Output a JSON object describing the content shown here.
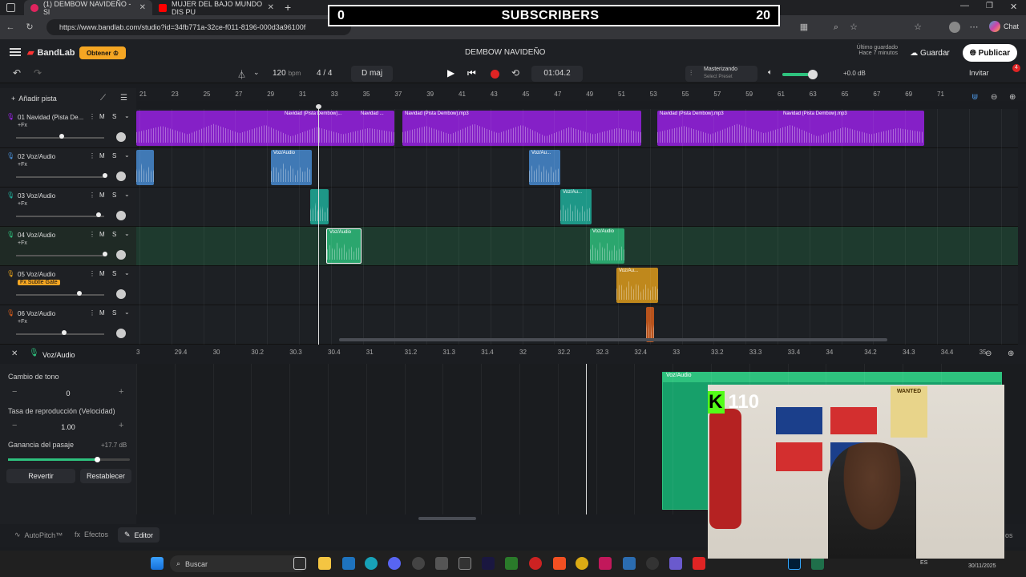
{
  "browser": {
    "tabs": [
      {
        "label": "(1) DEMBOW NAVIDEÑO - Sl"
      },
      {
        "label": "MUJER DEL BAJO MUNDO DIS PU"
      }
    ],
    "new_tab": "+",
    "url": "https://www.bandlab.com/studio?id=34fb771a-32ce-f011-8196-000d3a96100f",
    "chat_label": "Chat"
  },
  "overlay": {
    "left": "0",
    "label": "SUBSCRIBERS",
    "right": "20"
  },
  "app": {
    "brand": "BandLab",
    "get_button": "Obtener",
    "project_title": "DEMBOW NAVIDEÑO",
    "saved_line1": "Último guardado",
    "saved_line2": "Hace 7 minutos",
    "save_button": "Guardar",
    "publish_button": "Publicar",
    "invite_button": "Invitar",
    "invite_badge": "4"
  },
  "transport": {
    "bpm": "120",
    "bpm_unit": "bpm",
    "signature": "4 / 4",
    "key": "D maj",
    "time": "01:04.2",
    "mastering_title": "Masterizando",
    "mastering_sub": "Select Preset",
    "db": "+0.0 dB"
  },
  "tracks_header": {
    "add_track": "Añadir pista"
  },
  "ruler": [
    "21",
    "23",
    "25",
    "27",
    "29",
    "31",
    "33",
    "35",
    "37",
    "39",
    "41",
    "43",
    "45",
    "47",
    "49",
    "51",
    "53",
    "55",
    "57",
    "59",
    "61",
    "63",
    "65",
    "67",
    "69",
    "71"
  ],
  "tracks": [
    {
      "num": "01",
      "name": "Navidad (Pista De...",
      "fx": "+Fx",
      "color": "#a020f0",
      "vol": 0.5
    },
    {
      "num": "02",
      "name": "Voz/Audio",
      "fx": "+Fx",
      "color": "#4a90d9",
      "vol": 1.0
    },
    {
      "num": "03",
      "name": "Voz/Audio",
      "fx": "+Fx",
      "color": "#1fb5a0",
      "vol": 0.93
    },
    {
      "num": "04",
      "name": "Voz/Audio",
      "fx": "+Fx",
      "color": "#2ec27e",
      "vol": 1.0
    },
    {
      "num": "05",
      "name": "Voz/Audio",
      "fx": "Fx Subtle Gate",
      "color": "#e8a21a",
      "vol": 0.7
    },
    {
      "num": "06",
      "name": "Voz/Audio",
      "fx": "+Fx",
      "color": "#e0601a",
      "vol": 0.53
    }
  ],
  "track_buttons": {
    "m": "M",
    "s": "S"
  },
  "clips": {
    "t1": [
      "Navidad (Pista Dembow)...",
      "Navidad ...",
      "Navidad (Pista Dembow).mp3",
      "Navidad (Pista Dembow).mp3",
      "Navidad (Pista Dembow).mp3"
    ],
    "t2": [
      "Voz/Audio",
      "Voz/Au..."
    ],
    "t3": [
      "Voz/Au..."
    ],
    "t4": [
      "Voz/Audio",
      "Voz/Audio"
    ],
    "t5": [
      "Voz/Au..."
    ]
  },
  "editor": {
    "track_label": "Voz/Audio",
    "ruler": [
      "3",
      "29.4",
      "30",
      "30.2",
      "30.3",
      "30.4",
      "31",
      "31.2",
      "31.3",
      "31.4",
      "32",
      "32.2",
      "32.3",
      "32.4",
      "33",
      "33.2",
      "33.3",
      "33.4",
      "34",
      "34.2",
      "34.3",
      "34.4",
      "35"
    ],
    "pitch_label": "Cambio de tono",
    "pitch_value": "0",
    "speed_label": "Tasa de reproducción (Velocidad)",
    "speed_value": "1.00",
    "gain_label": "Ganancia del pasaje",
    "gain_value": "+17.7 dB",
    "revert": "Revertir",
    "reset": "Restablecer",
    "clip_label": "Voz/Audio"
  },
  "bottom_tabs": {
    "autopitch": "AutoPitch™",
    "effects": "Efectos",
    "editor": "Editor"
  },
  "webcam": {
    "kick_count": "110",
    "poster_text": "WANTED"
  },
  "taskbar": {
    "search": "Buscar",
    "lang": "ES",
    "time": "30/11/2025",
    "right_edge": "os"
  }
}
